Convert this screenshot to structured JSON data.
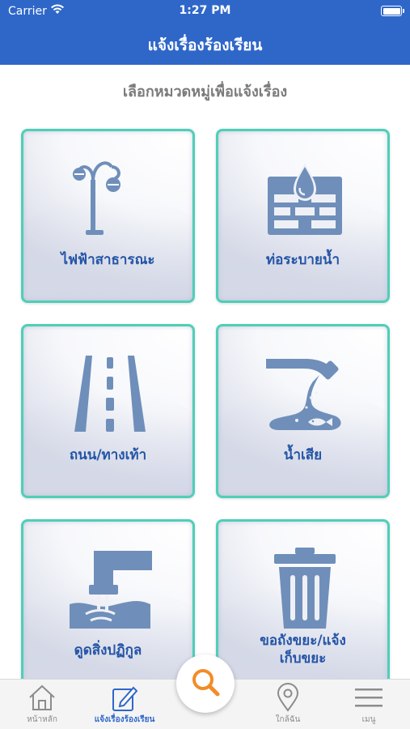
{
  "status_bar": {
    "carrier": "Carrier",
    "time": "1:27 PM"
  },
  "nav": {
    "title": "แจ้งเรื่องร้องเรียน"
  },
  "subtitle": "เลือกหมวดหมู่เพื่อแจ้งเรื่อง",
  "categories": [
    {
      "label": "ไฟฟ้าสาธารณะ",
      "icon": "street-light-icon"
    },
    {
      "label": "ท่อระบายน้ำ",
      "icon": "drainage-icon"
    },
    {
      "label": "ถนน/ทางเท้า",
      "icon": "road-icon"
    },
    {
      "label": "น้ำเสีย",
      "icon": "wastewater-icon"
    },
    {
      "label": "ดูดสิ่งปฏิกูล",
      "icon": "sewage-pipe-icon"
    },
    {
      "label_line1": "ขอถังขยะ/แจ้ง",
      "label_line2": "เก็บขยะ",
      "icon": "trash-bin-icon"
    }
  ],
  "tabbar": {
    "home": "หน้าหลัก",
    "report": "แจ้งเรื่องร้องเรียน",
    "nearby": "ใกล้ฉัน",
    "menu": "เมนู"
  },
  "colors": {
    "primary": "#2f67c9",
    "tile_border": "#4fcfb8",
    "icon": "#6f8fba",
    "label": "#2454a6",
    "search_accent": "#f28c28"
  }
}
